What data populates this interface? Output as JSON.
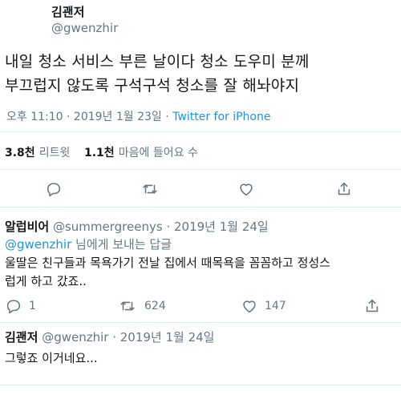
{
  "main_tweet": {
    "author_name": "김괜저",
    "author_handle": "@gwenzhir",
    "text_line1": "내일 청소 서비스 부른 날이다 청소 도우미 분께",
    "text_line2": "부끄럽지 않도록 구석구석 청소를 잘 해놔야지",
    "timestamp": "오후 11:10 · 2019년 1월 23일 ·",
    "source": "Twitter for iPhone",
    "retweets_count": "3.8천",
    "retweets_label": "리트윗",
    "likes_count": "1.1천",
    "likes_label": "마음에 들어요 수"
  },
  "replies": [
    {
      "author_name": "알럽비어",
      "author_handle": "@summergreenys · 2019년 1월 24일",
      "reply_to_mention": "@gwenzhir",
      "reply_to_suffix": "님에게 보내는 답글",
      "text_line1": "울딸은 친구들과 목욕가기 전날 집에서 때목욕을 꼼꼼하고 정성스",
      "text_line2": "럽게 하고 갔죠..",
      "reply_count": "1",
      "retweet_count": "624",
      "like_count": "147"
    },
    {
      "author_name": "김괜저",
      "author_handle": "@gwenzhir · 2019년 1월 24일",
      "text_line1": "그렇죠 이거네요..."
    }
  ],
  "icons": {
    "reply": "reply-icon",
    "retweet": "retweet-icon",
    "like": "heart-icon",
    "share": "share-icon"
  },
  "colors": {
    "text": "#14171a",
    "secondary": "#657786",
    "link": "#1b95e0",
    "divider": "#e1e8ed"
  }
}
